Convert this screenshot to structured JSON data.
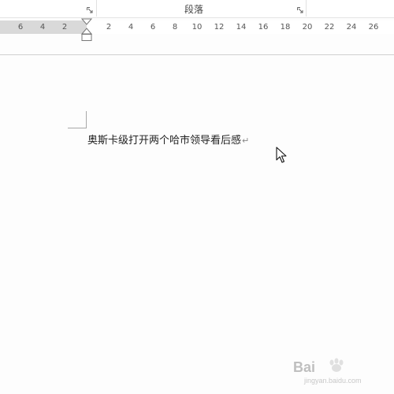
{
  "ribbon": {
    "group_label": "段落"
  },
  "ruler": {
    "left_ticks": [
      "6",
      "4",
      "2"
    ],
    "right_ticks": [
      "2",
      "4",
      "6",
      "8",
      "10",
      "12",
      "14",
      "16",
      "18",
      "20",
      "22",
      "24",
      "26"
    ]
  },
  "document": {
    "line_text": "奥斯卡级打开两个哈市领导看后感",
    "paragraph_mark": "↵"
  },
  "watermark": {
    "text": "Bai",
    "sub": "jingyan.baidu.com"
  },
  "icons": {
    "launcher": "dialog-launcher-icon",
    "indent": "indent-marker-icon",
    "cursor": "mouse-pointer-icon",
    "logo": "baidu-paw-logo"
  }
}
